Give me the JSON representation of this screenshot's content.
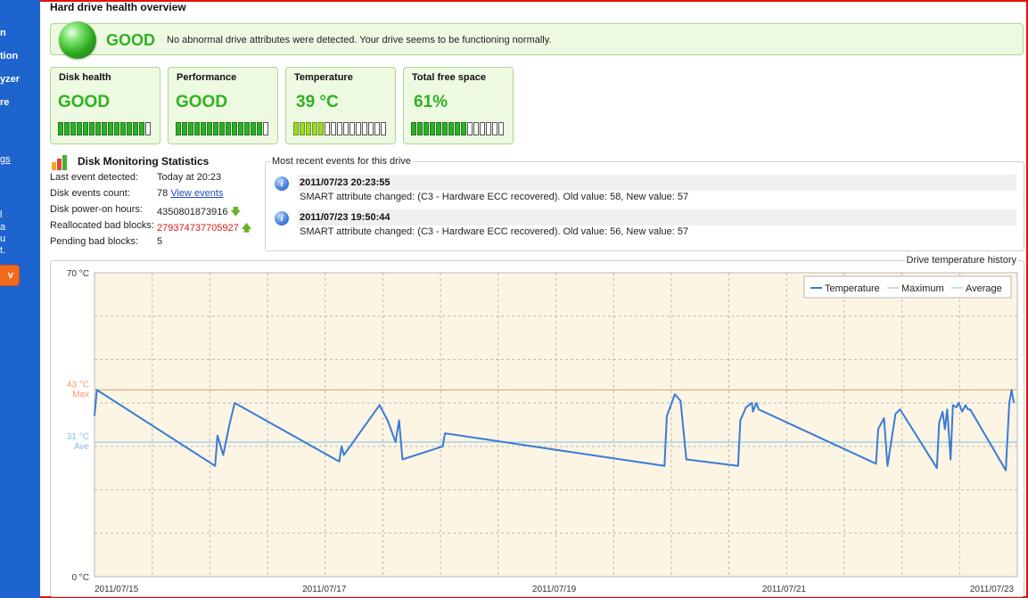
{
  "sidebar": {
    "items": [
      "n",
      "tion",
      "yzer",
      "re"
    ],
    "link": "gs",
    "promo": [
      "l",
      "a",
      "u",
      "t."
    ],
    "button": "v"
  },
  "page_title": "Hard drive health overview",
  "status": {
    "word": "GOOD",
    "message": "No abnormal drive attributes were detected. Your drive seems to be functioning normally.",
    "color": "#2db31f"
  },
  "cards": [
    {
      "title": "Disk health",
      "value": "GOOD",
      "level": 0.93
    },
    {
      "title": "Performance",
      "value": "GOOD",
      "level": 0.93
    },
    {
      "title": "Temperature",
      "value": "39 °C",
      "level": 0.33
    },
    {
      "title": "Total free space",
      "value": "61%",
      "level": 0.6
    }
  ],
  "stats": {
    "title": "Disk Monitoring Statistics",
    "rows": [
      {
        "label": "Last event detected:",
        "value": "Today at 20:23"
      },
      {
        "label": "Disk events count:",
        "value": "78",
        "link": "View events"
      },
      {
        "label": "Disk power-on hours:",
        "value": "4350801873916",
        "trend": "down"
      },
      {
        "label": "Reallocated bad blocks:",
        "value": "279374737705927",
        "trend": "up"
      },
      {
        "label": "Pending bad blocks:",
        "value": "5"
      }
    ]
  },
  "events": {
    "title": "Most recent events for this drive",
    "items": [
      {
        "time": "2011/07/23 20:23:55",
        "text": "SMART attribute changed: (C3 - Hardware ECC recovered). Old value: 58, New value: 57"
      },
      {
        "time": "2011/07/23 19:50:44",
        "text": "SMART attribute changed: (C3 - Hardware ECC recovered). Old value: 56, New value: 57"
      }
    ]
  },
  "chart_data": {
    "type": "line",
    "title": "Drive temperature history",
    "ylim": [
      0,
      70
    ],
    "y_ticks": [
      "70 °C",
      "0 °C"
    ],
    "x_ticks": [
      {
        "label": "2011/07/15",
        "day": 0
      },
      {
        "label": "2011/07/17",
        "day": 2
      },
      {
        "label": "2011/07/19",
        "day": 4
      },
      {
        "label": "2011/07/21",
        "day": 6
      },
      {
        "label": "2011/07/23",
        "day": 8
      }
    ],
    "xlim_days": [
      0,
      8.03
    ],
    "grid": true,
    "legend": "top-right",
    "max": {
      "value": 43,
      "label": "43 °C",
      "sublabel": "Max",
      "color": "#f29a6a"
    },
    "average": {
      "value": 31,
      "label": "31 °C",
      "sublabel": "Ave",
      "color": "#7ec0e6"
    },
    "series": [
      {
        "name": "Temperature",
        "color": "#3a7bd5",
        "points": [
          [
            0.0,
            37
          ],
          [
            0.02,
            43
          ],
          [
            1.05,
            25.5
          ],
          [
            1.07,
            32.5
          ],
          [
            1.12,
            28
          ],
          [
            1.17,
            34.5
          ],
          [
            1.22,
            40
          ],
          [
            2.13,
            26.5
          ],
          [
            2.15,
            30
          ],
          [
            2.17,
            28
          ],
          [
            2.48,
            39.5
          ],
          [
            2.55,
            36
          ],
          [
            2.62,
            31
          ],
          [
            2.65,
            36
          ],
          [
            2.68,
            27
          ],
          [
            3.03,
            30
          ],
          [
            3.05,
            33
          ],
          [
            4.96,
            25.5
          ],
          [
            4.98,
            37
          ],
          [
            5.05,
            42
          ],
          [
            5.1,
            40.5
          ],
          [
            5.15,
            27
          ],
          [
            5.6,
            25.5
          ],
          [
            5.62,
            36
          ],
          [
            5.67,
            39
          ],
          [
            5.72,
            40
          ],
          [
            5.73,
            38
          ],
          [
            5.76,
            40
          ],
          [
            5.78,
            38.5
          ],
          [
            6.8,
            26
          ],
          [
            6.82,
            34
          ],
          [
            6.87,
            36.5
          ],
          [
            6.9,
            25.5
          ],
          [
            6.97,
            37.5
          ],
          [
            6.99,
            38
          ],
          [
            7.01,
            38.5
          ],
          [
            7.33,
            25
          ],
          [
            7.35,
            35.5
          ],
          [
            7.38,
            38
          ],
          [
            7.4,
            34
          ],
          [
            7.42,
            38.5
          ],
          [
            7.45,
            27
          ],
          [
            7.47,
            39.5
          ],
          [
            7.5,
            39
          ],
          [
            7.52,
            40
          ],
          [
            7.55,
            38
          ],
          [
            7.58,
            39.5
          ],
          [
            7.6,
            38.5
          ],
          [
            7.62,
            38.5
          ],
          [
            7.93,
            24.5
          ],
          [
            7.96,
            40
          ],
          [
            7.98,
            43
          ],
          [
            8.0,
            40
          ]
        ]
      },
      {
        "name": "Maximum",
        "color": "#f29a6a"
      },
      {
        "name": "Average",
        "color": "#7ec0e6"
      }
    ]
  }
}
